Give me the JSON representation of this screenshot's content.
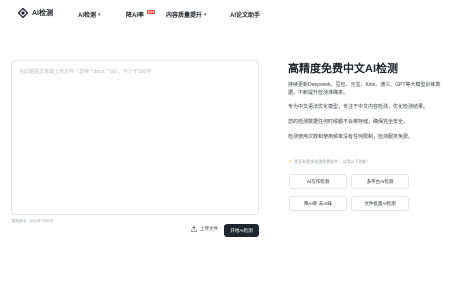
{
  "nav": {
    "brand": "AI检测",
    "items": [
      {
        "label": "AI检测",
        "has_chevron": true
      },
      {
        "label": "降AI率",
        "badge": "HOT"
      },
      {
        "label": "内容质量提升",
        "has_chevron": true
      },
      {
        "label": "AI论文助手"
      }
    ]
  },
  "editor": {
    "placeholder": "在此粘贴文本或上传文件（支持 *.docx, *.txt），不少于300字"
  },
  "footnote": "模型版本：2024年7月30日",
  "actions": {
    "upload_label": "上传文件",
    "detect_label": "开始AI检测"
  },
  "side": {
    "title": "高精度免费中文AI检测",
    "paragraphs": [
      "持续更新Deepseek、豆包、元宝、Kimi、通义、GPT等大模型训练数据，不断提升检测准确率。",
      "专为中文语法优化模型，专注于中文内容检测，优化检测结果。",
      "您的检测数据任何时候都不会被存储，确保完全安全。",
      "检测使用次数和使用频率没有任何限制，检测服务免费。"
    ],
    "hint": "是否有更多检测免费软件，试用以下功能：",
    "feature_buttons": [
      "AI写作检测",
      "多平台AI检测",
      "降AI率·去AI味",
      "文件批量AI检测"
    ]
  },
  "colors": {
    "accent_dark": "#1e2530",
    "badge": "#e9453b",
    "hint_icon": "#f0b429"
  }
}
